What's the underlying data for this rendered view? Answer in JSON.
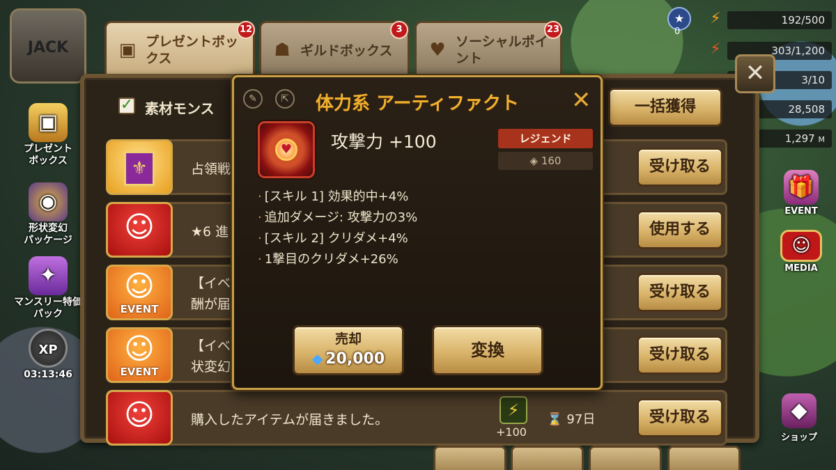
{
  "hud": {
    "arena_count": "0",
    "energy": "192/500",
    "arena_wings": "303/1,200",
    "crystals_small": "3/10",
    "mana": "28,508",
    "glory": "1,297",
    "glory_suffix": "M"
  },
  "profile": {
    "name_text": "JACK"
  },
  "left_menu": [
    {
      "label": "プレゼント\nボックス",
      "icon": "treasure-chest-icon"
    },
    {
      "label": "形状変幻\nパッケージ",
      "icon": "eye-emblem-icon"
    },
    {
      "label": "マンスリー特価\nパック",
      "icon": "scroll-pack-icon"
    },
    {
      "label": "03:13:46",
      "icon": "xp-icon",
      "icon_text": "XP"
    }
  ],
  "right_menu": [
    {
      "label": "EVENT",
      "icon": "gift-icon"
    },
    {
      "label": "MEDIA",
      "icon": "tv-icon"
    },
    {
      "label": "ショップ",
      "icon": "crystal-shop-icon"
    }
  ],
  "tabs": [
    {
      "label": "プレゼントボックス",
      "badge": "12"
    },
    {
      "label": "ギルドボックス",
      "badge": "3"
    },
    {
      "label": "ソーシャルポイント",
      "badge": "23"
    }
  ],
  "mailbox": {
    "filter_label": "素材モンス",
    "collect_all": "一括獲得",
    "rows": [
      {
        "text": "占領戦",
        "button": "受け取る",
        "icon_type": "guild-banner"
      },
      {
        "text": "★6 進",
        "button": "使用する",
        "icon_type": "smile"
      },
      {
        "text": "【イベン\n酬が届",
        "button": "受け取る",
        "icon_type": "event",
        "event_tag": "EVENT"
      },
      {
        "text": "【イベン\n状変幻",
        "button": "受け取る",
        "icon_type": "event",
        "event_tag": "EVENT"
      },
      {
        "text": "購入したアイテムが届きました。",
        "button": "受け取る",
        "icon_type": "smile",
        "item_qty": "+100",
        "expire": "97日"
      }
    ]
  },
  "artifact_popup": {
    "title": "体力系 アーティファクト",
    "main_stat": "攻撃力 +100",
    "grade": "レジェンド",
    "power": "160",
    "substats": [
      "[スキル 1] 効果的中+4%",
      "追加ダメージ: 攻撃力の3%",
      "[スキル 2] クリダメ+4%",
      "1撃目のクリダメ+26%"
    ],
    "sell_label": "売却",
    "sell_price": "20,000",
    "convert_label": "変換"
  },
  "colors": {
    "title_gold": "#f0b030",
    "legend_red": "#a8331c",
    "badge_red": "#c0191c",
    "panel_brown": "#2b2218"
  }
}
